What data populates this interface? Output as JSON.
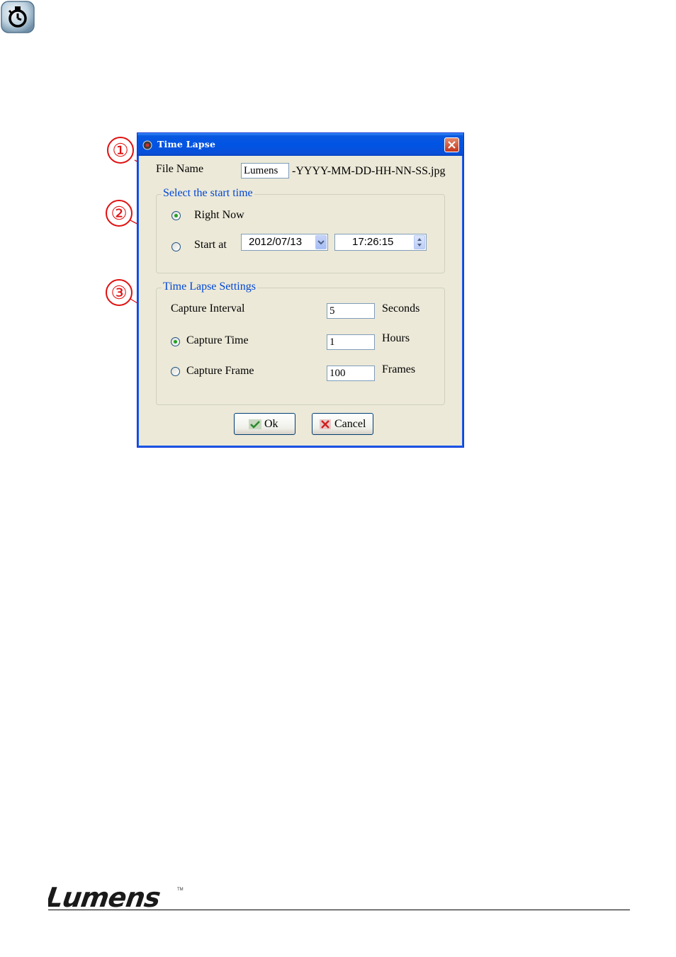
{
  "doc": {
    "callouts": [
      "①",
      "②",
      "③"
    ],
    "logo_text": "Lumens",
    "logo_tm": "TM"
  },
  "dialog": {
    "title": "Time Lapse",
    "file_name_label": "File Name",
    "file_name_value": "Lumens",
    "file_suffix": "-YYYY-MM-DD-HH-NN-SS.jpg",
    "start_group": {
      "legend": "Select the start time",
      "right_now_label": "Right Now",
      "start_at_label": "Start at",
      "date_value": "2012/07/13",
      "time_value": "17:26:15",
      "selected": "Right Now"
    },
    "settings_group": {
      "legend": "Time Lapse Settings",
      "interval_label": "Capture Interval",
      "interval_value": "5",
      "interval_unit": "Seconds",
      "capture_time_label": "Capture Time",
      "capture_time_value": "1",
      "capture_time_unit": "Hours",
      "capture_frame_label": "Capture Frame",
      "capture_frame_value": "100",
      "capture_frame_unit": "Frames",
      "selected": "Capture Time"
    },
    "ok_label": "Ok",
    "cancel_label": "Cancel"
  },
  "colors": {
    "titlebar": "#0054e3",
    "dialog_bg": "#ece9d8",
    "legend_text": "#0046d5",
    "callout": "#e01010",
    "radio_dot": "#21a121"
  },
  "icons": [
    "timer-icon",
    "app-icon",
    "close-icon",
    "dropdown-arrow-icon",
    "spin-arrows-icon",
    "check-icon",
    "x-icon"
  ]
}
